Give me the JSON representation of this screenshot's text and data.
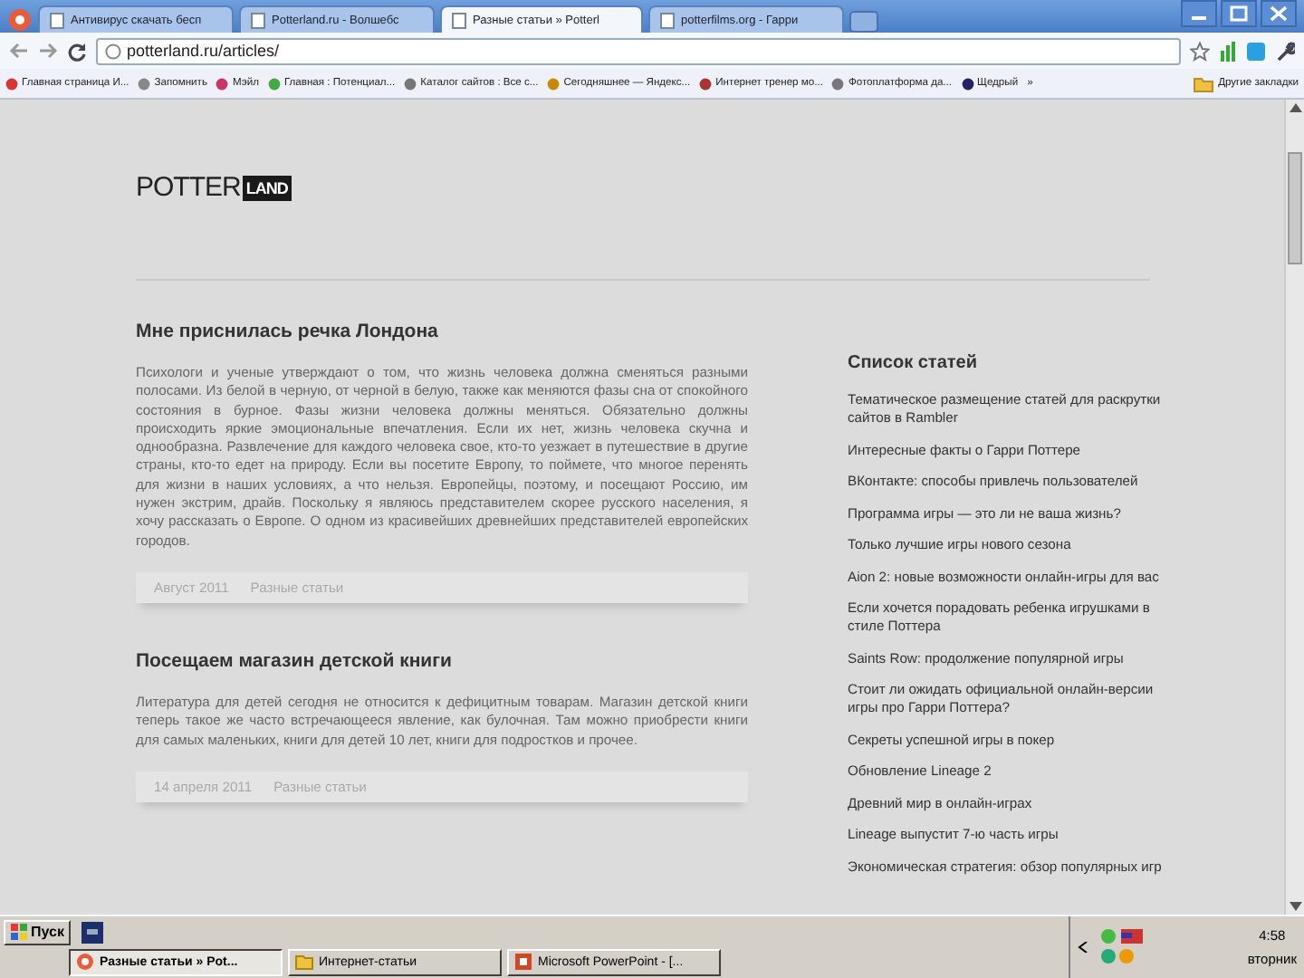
{
  "tabs": [
    {
      "title": "Антивирус скачать бесп",
      "selected": false
    },
    {
      "title": "Potterland.ru - Волшебс",
      "selected": false
    },
    {
      "title": "Разные статьи » Potterl",
      "selected": true
    },
    {
      "title": "potterfilms.org - Гарри",
      "selected": false
    }
  ],
  "address": {
    "url": "potterland.ru/articles/"
  },
  "bookmarks": {
    "items": [
      "Главная страница И...",
      "Запомнить",
      "Мэйл",
      "Главная : Потенциал...",
      "Каталог сайтов : Все с...",
      "Сегодняшнее — Яндекс...",
      "Интернет тренер мо...",
      "Фотоплатформа да...",
      "Щедрый"
    ],
    "more": "»",
    "other": "Другие закладки"
  },
  "logo": {
    "left": "POTTER",
    "right": "LAND"
  },
  "articles": [
    {
      "title": "Мне приснилась речка Лондона",
      "text": "Психологи и ученые утверждают о том, что жизнь человека должна сменяться разными полосами. Из белой в черную, от черной в белую, также как меняются фазы сна от спокойного состояния в бурное. Фазы жизни человека должны меняться. Обязательно должны происходить яркие эмоциональные впечатления. Если их нет, жизнь человека скучна и однообразна. Развлечение для каждого человека свое, кто-то уезжает в путешествие в другие страны, кто-то едет на природу. Если вы посетите Европу, то поймете, что многое перенять для жизни в наших условиях, а что нельзя. Европейцы, поэтому, и посещают Россию, им нужен экстрим, драйв. Поскольку я являюсь представителем скорее русского населения, я хочу рассказать о Европе. О одном из красивейших древнейших представителей европейских городов.",
      "date": "Август 2011",
      "category": "Разные статьи"
    },
    {
      "title": "Посещаем магазин детской книги",
      "text": "Литература для детей сегодня не относится к дефицитным товарам. Магазин детской книги теперь такое же часто встречающееся явление, как булочная. Там можно приобрести книги для самых маленьких, книги для детей 10 лет, книги для подростков и прочее.",
      "date": "14 апреля 2011",
      "category": "Разные статьи"
    }
  ],
  "sidebar": {
    "title": "Список статей",
    "items": [
      "Тематическое размещение статей для раскрутки сайтов в Rambler",
      "Интересные факты о Гарри Поттере",
      "ВКонтакте: способы привлечь пользователей",
      "Программа игры — это ли не ваша жизнь?",
      "Только лучшие игры нового сезона",
      "Aion 2: новые возможности онлайн-игры для вас",
      "Если хочется порадовать ребенка игрушками в стиле Поттера",
      "Saints Row: продолжение популярной игры",
      "Стоит ли ожидать официальной онлайн-версии игры про Гарри Поттера?",
      "Секреты успешной игры в покер",
      "Обновление Lineage 2",
      "Древний мир в онлайн-играх",
      "Lineage выпустит 7-ю часть игры",
      "Экономическая стратегия: обзор популярных игр"
    ]
  },
  "taskbar": {
    "start": "Пуск",
    "tasks": [
      {
        "title": "Разные статьи » Pot...",
        "selected": true
      },
      {
        "title": "Интернет-статьи",
        "selected": false
      },
      {
        "title": "Microsoft PowerPoint - [...",
        "selected": false
      }
    ],
    "time": "4:58",
    "day": "вторник"
  }
}
